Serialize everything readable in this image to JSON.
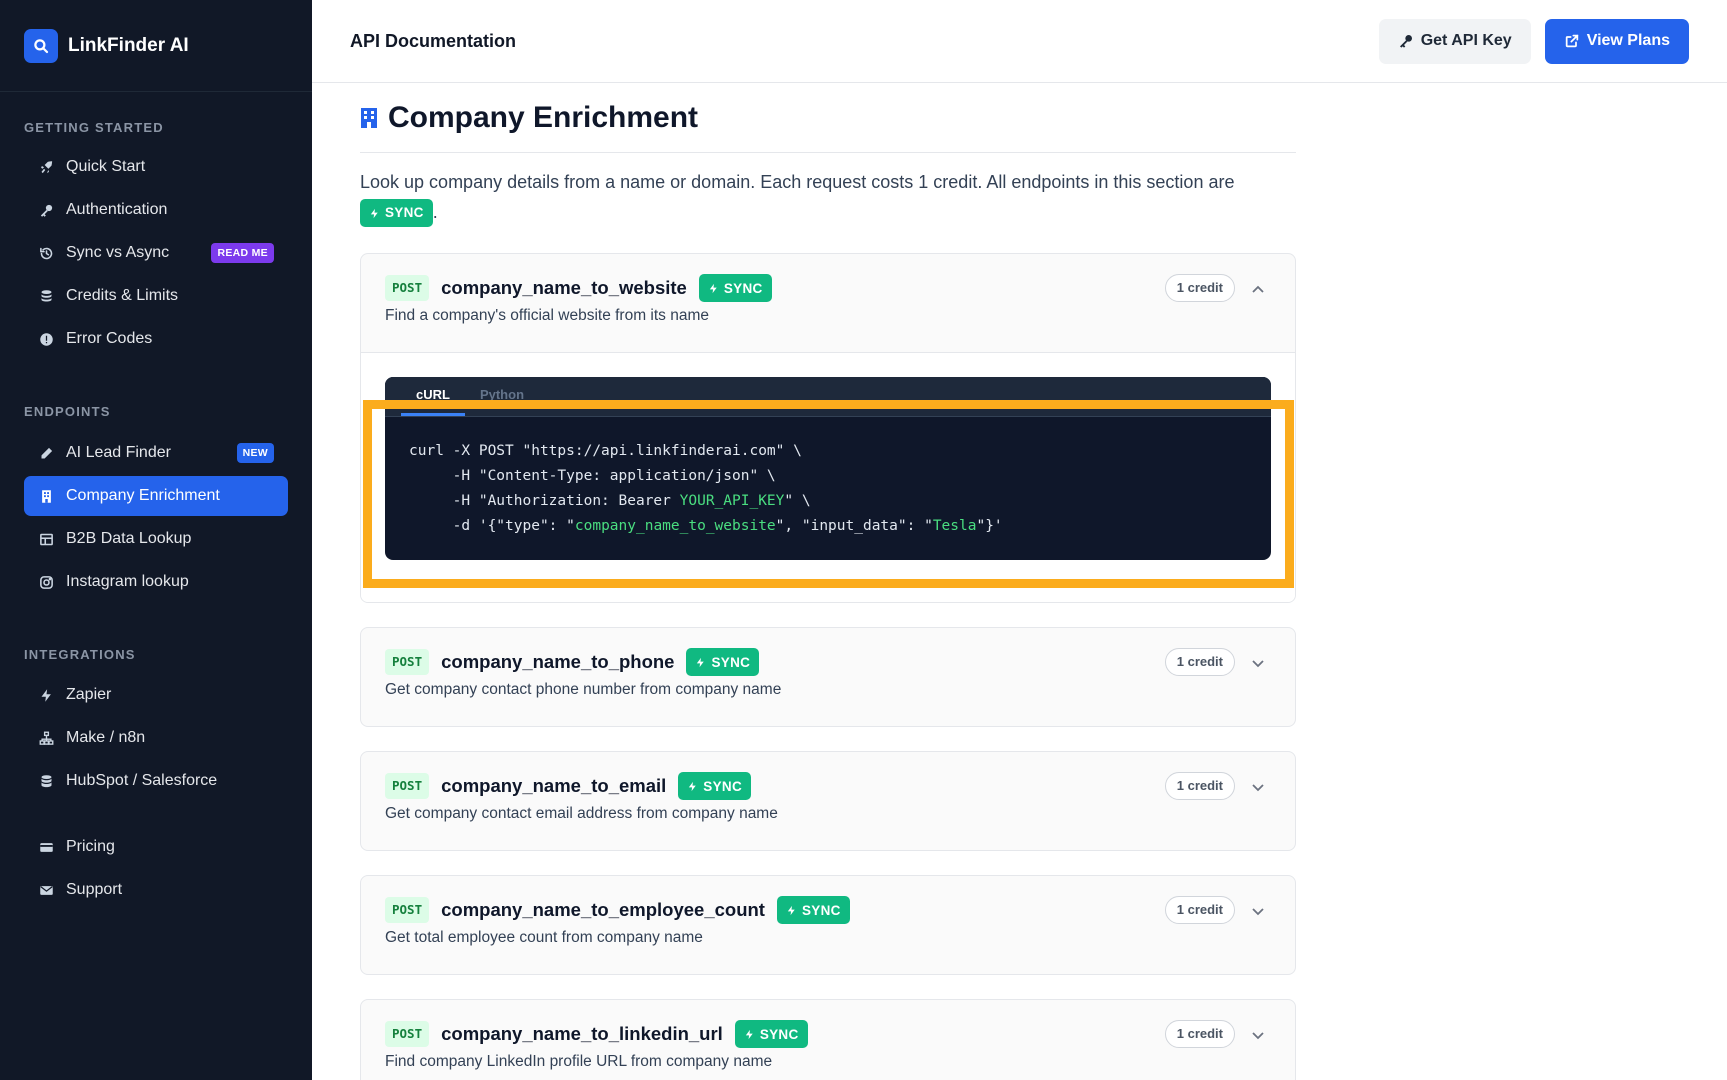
{
  "app": {
    "name": "LinkFinder AI"
  },
  "sidebar": {
    "sections": [
      {
        "heading": "GETTING STARTED",
        "items": [
          {
            "label": "Quick Start",
            "icon": "rocket-icon"
          },
          {
            "label": "Authentication",
            "icon": "key-icon"
          },
          {
            "label": "Sync vs Async",
            "icon": "history-icon",
            "badge": "READ ME"
          },
          {
            "label": "Credits & Limits",
            "icon": "coins-icon"
          },
          {
            "label": "Error Codes",
            "icon": "alert-circle-icon"
          }
        ]
      },
      {
        "heading": "ENDPOINTS",
        "items": [
          {
            "label": "AI Lead Finder",
            "icon": "pencil-icon",
            "badge": "NEW"
          },
          {
            "label": "Company Enrichment",
            "icon": "building-icon",
            "active": true
          },
          {
            "label": "B2B Data Lookup",
            "icon": "table-icon"
          },
          {
            "label": "Instagram lookup",
            "icon": "instagram-icon"
          }
        ]
      },
      {
        "heading": "INTEGRATIONS",
        "items": [
          {
            "label": "Zapier",
            "icon": "bolt-icon"
          },
          {
            "label": "Make / n8n",
            "icon": "network-icon"
          },
          {
            "label": "HubSpot / Salesforce",
            "icon": "database-icon"
          }
        ]
      },
      {
        "heading": "",
        "items": [
          {
            "label": "Pricing",
            "icon": "credit-card-icon"
          },
          {
            "label": "Support",
            "icon": "envelope-icon"
          }
        ]
      }
    ]
  },
  "header": {
    "title": "API Documentation",
    "get_key_label": "Get API Key",
    "view_plans_label": "View Plans"
  },
  "main": {
    "title": "Company Enrichment",
    "intro": "Look up company details from a name or domain. Each request costs 1 credit. All endpoints in this section are",
    "intro_badge": "SYNC",
    "intro_end": "."
  },
  "endpoints": [
    {
      "method": "POST",
      "name": "company_name_to_website",
      "badge": "SYNC",
      "credit": "1 credit",
      "desc": "Find a company's official website from its name",
      "expanded": true
    },
    {
      "method": "POST",
      "name": "company_name_to_phone",
      "badge": "SYNC",
      "credit": "1 credit",
      "desc": "Get company contact phone number from company name"
    },
    {
      "method": "POST",
      "name": "company_name_to_email",
      "badge": "SYNC",
      "credit": "1 credit",
      "desc": "Get company contact email address from company name"
    },
    {
      "method": "POST",
      "name": "company_name_to_employee_count",
      "badge": "SYNC",
      "credit": "1 credit",
      "desc": "Get total employee count from company name"
    },
    {
      "method": "POST",
      "name": "company_name_to_linkedin_url",
      "badge": "SYNC",
      "credit": "1 credit",
      "desc": "Find company LinkedIn profile URL from company name"
    }
  ],
  "code": {
    "tabs": [
      "cURL",
      "Python"
    ],
    "active_tab": "cURL",
    "l1": "curl -X POST \"https://api.linkfinderai.com\" \\",
    "l2": "     -H \"Content-Type: application/json\" \\",
    "l3a": "     -H \"Authorization: Bearer ",
    "l3b": "YOUR_API_KEY",
    "l3c": "\" \\",
    "l4a": "     -d '{\"type\": \"",
    "l4b": "company_name_to_website",
    "l4c": "\", \"input_data\": \"",
    "l4d": "Tesla",
    "l4e": "\"}'"
  },
  "colors": {
    "accent": "#2563eb",
    "sync": "#10b981",
    "highlight": "#fbac1d",
    "sidebar_bg": "#111827"
  }
}
